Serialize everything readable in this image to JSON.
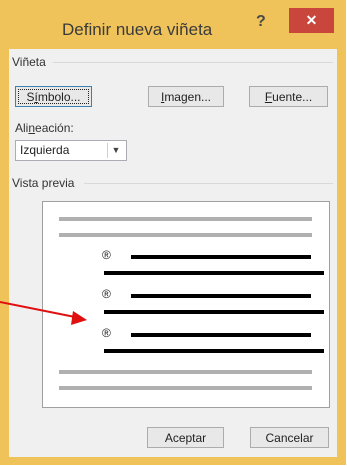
{
  "title": "Definir nueva viñeta",
  "help_label": "?",
  "close_label": "✕",
  "section_bullet": "Viñeta",
  "symbol_pre": "S",
  "symbol_ul": "í",
  "symbol_post": "mbolo...",
  "image_pre": "",
  "image_ul": "I",
  "image_post": "magen...",
  "font_ul": "F",
  "font_post": "uente...",
  "align_pre": "Ali",
  "align_ul": "n",
  "align_post": "eación:",
  "align_value": "Izquierda",
  "section_preview": "Vista previa",
  "bullet_char": "®",
  "ok": "Aceptar",
  "cancel": "Cancelar",
  "colors": {
    "frame": "#efc35a",
    "close": "#c9463d",
    "arrow": "#e01010"
  }
}
